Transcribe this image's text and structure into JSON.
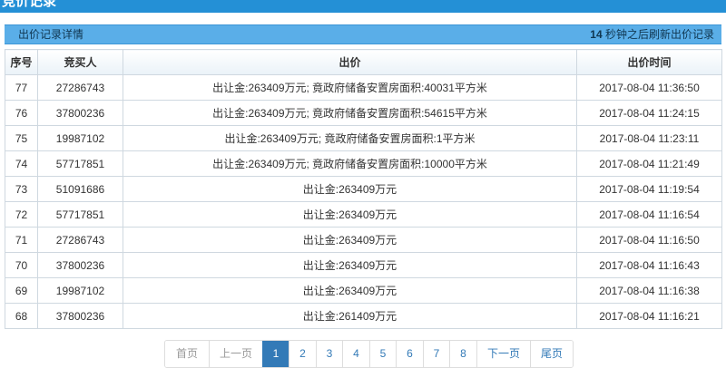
{
  "header": {
    "title": "竞价记录"
  },
  "info_bar": {
    "title": "出价记录详情",
    "refresh_seconds": "14",
    "refresh_suffix": " 秒钟之后刷新出价记录"
  },
  "table": {
    "columns": [
      "序号",
      "竞买人",
      "出价",
      "出价时间"
    ],
    "rows": [
      [
        "77",
        "27286743",
        "出让金:263409万元; 竟政府储备安置房面积:40031平方米",
        "2017-08-04 11:36:50"
      ],
      [
        "76",
        "37800236",
        "出让金:263409万元; 竟政府储备安置房面积:54615平方米",
        "2017-08-04 11:24:15"
      ],
      [
        "75",
        "19987102",
        "出让金:263409万元; 竟政府储备安置房面积:1平方米",
        "2017-08-04 11:23:11"
      ],
      [
        "74",
        "57717851",
        "出让金:263409万元; 竟政府储备安置房面积:10000平方米",
        "2017-08-04 11:21:49"
      ],
      [
        "73",
        "51091686",
        "出让金:263409万元",
        "2017-08-04 11:19:54"
      ],
      [
        "72",
        "57717851",
        "出让金:263409万元",
        "2017-08-04 11:16:54"
      ],
      [
        "71",
        "27286743",
        "出让金:263409万元",
        "2017-08-04 11:16:50"
      ],
      [
        "70",
        "37800236",
        "出让金:263409万元",
        "2017-08-04 11:16:43"
      ],
      [
        "69",
        "19987102",
        "出让金:263409万元",
        "2017-08-04 11:16:38"
      ],
      [
        "68",
        "37800236",
        "出让金:261409万元",
        "2017-08-04 11:16:21"
      ]
    ]
  },
  "pagination": {
    "first": "首页",
    "prev": "上一页",
    "pages": [
      "1",
      "2",
      "3",
      "4",
      "5",
      "6",
      "7",
      "8"
    ],
    "current": "1",
    "next": "下一页",
    "last": "尾页"
  },
  "colors": {
    "banner": "#2490d6",
    "info_bar": "#5aaee8",
    "active_page": "#337ab7"
  }
}
